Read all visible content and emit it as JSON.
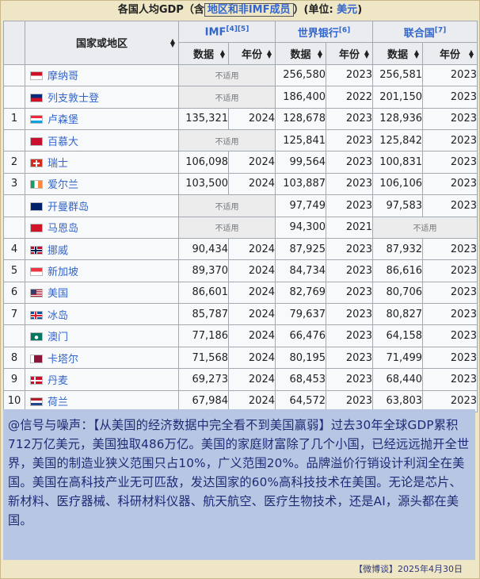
{
  "caption": {
    "prefix": "各国人均GDP（含",
    "highlight": "地区和非IMF成员",
    "suffix": "）(单位: ",
    "unit": "美元",
    "close": ")"
  },
  "headers": {
    "country": "国家或地区",
    "sources": [
      {
        "name": "IMF",
        "refs": "[4][5]"
      },
      {
        "name": "世界银行",
        "refs": "[6]"
      },
      {
        "name": "联合国",
        "refs": "[7]"
      }
    ],
    "value": "数据",
    "year": "年份"
  },
  "not_applicable": "不适用",
  "rows": [
    {
      "rank": "",
      "name": "摩纳哥",
      "flag": "monaco",
      "imf": null,
      "wb": [
        "256,580",
        "2023"
      ],
      "un": [
        "256,581",
        "2023"
      ]
    },
    {
      "rank": "",
      "name": "列支敦士登",
      "flag": "liechtenstein",
      "imf": null,
      "wb": [
        "186,400",
        "2022"
      ],
      "un": [
        "201,150",
        "2023"
      ]
    },
    {
      "rank": "1",
      "name": "卢森堡",
      "flag": "luxembourg",
      "imf": [
        "135,321",
        "2024"
      ],
      "wb": [
        "128,678",
        "2023"
      ],
      "un": [
        "128,936",
        "2023"
      ]
    },
    {
      "rank": "",
      "name": "百慕大",
      "flag": "bermuda",
      "imf": null,
      "wb": [
        "125,841",
        "2023"
      ],
      "un": [
        "125,842",
        "2023"
      ]
    },
    {
      "rank": "2",
      "name": "瑞士",
      "flag": "switzerland",
      "imf": [
        "106,098",
        "2024"
      ],
      "wb": [
        "99,564",
        "2023"
      ],
      "un": [
        "100,831",
        "2023"
      ]
    },
    {
      "rank": "3",
      "name": "爱尔兰",
      "flag": "ireland",
      "imf": [
        "103,500",
        "2024"
      ],
      "wb": [
        "103,887",
        "2023"
      ],
      "un": [
        "106,106",
        "2023"
      ]
    },
    {
      "rank": "",
      "name": "开曼群岛",
      "flag": "cayman",
      "imf": null,
      "wb": [
        "97,749",
        "2023"
      ],
      "un": [
        "97,583",
        "2023"
      ]
    },
    {
      "rank": "",
      "name": "马恩岛",
      "flag": "isleofman",
      "imf": null,
      "wb": [
        "94,300",
        "2021"
      ],
      "un": null
    },
    {
      "rank": "4",
      "name": "挪威",
      "flag": "norway",
      "imf": [
        "90,434",
        "2024"
      ],
      "wb": [
        "87,925",
        "2023"
      ],
      "un": [
        "87,932",
        "2023"
      ]
    },
    {
      "rank": "5",
      "name": "新加坡",
      "flag": "singapore",
      "imf": [
        "89,370",
        "2024"
      ],
      "wb": [
        "84,734",
        "2023"
      ],
      "un": [
        "86,616",
        "2023"
      ]
    },
    {
      "rank": "6",
      "name": "美国",
      "flag": "usa",
      "imf": [
        "86,601",
        "2024"
      ],
      "wb": [
        "82,769",
        "2023"
      ],
      "un": [
        "80,706",
        "2023"
      ]
    },
    {
      "rank": "7",
      "name": "冰岛",
      "flag": "iceland",
      "imf": [
        "85,787",
        "2024"
      ],
      "wb": [
        "79,637",
        "2023"
      ],
      "un": [
        "80,827",
        "2023"
      ]
    },
    {
      "rank": "",
      "name": "澳门",
      "flag": "macau",
      "imf": [
        "77,186",
        "2024"
      ],
      "wb": [
        "66,476",
        "2023"
      ],
      "un": [
        "64,158",
        "2023"
      ]
    },
    {
      "rank": "8",
      "name": "卡塔尔",
      "flag": "qatar",
      "imf": [
        "71,568",
        "2024"
      ],
      "wb": [
        "80,195",
        "2023"
      ],
      "un": [
        "71,499",
        "2023"
      ]
    },
    {
      "rank": "9",
      "name": "丹麦",
      "flag": "denmark",
      "imf": [
        "69,273",
        "2024"
      ],
      "wb": [
        "68,453",
        "2023"
      ],
      "un": [
        "68,440",
        "2023"
      ]
    },
    {
      "rank": "10",
      "name": "荷兰",
      "flag": "netherlands",
      "imf": [
        "67,984",
        "2024"
      ],
      "wb": [
        "64,572",
        "2023"
      ],
      "un": [
        "63,803",
        "2023"
      ]
    }
  ],
  "note": "@信号与噪声：【从美国的经济数据中完全看不到美国赢弱】过去30年全球GDP累积712万亿美元，美国独取486万亿。美国的家庭财富除了几个小国，已经远远抛开全世界，美国的制造业狭义范围只占10%，广义范围20%。品牌溢价行销设计利润全在美国。美国在高科技产业无可匹敌，发达国家的60%高科技技术在美国。无论是芯片、新材料、医疗器械、科研材料仪器、航天航空、医疗生物技术，还是AI，源头都在美国。",
  "footer": "【微博谈】2025年4月30日",
  "colors": {
    "link": "#3366cc",
    "note_bg": "#b7c6e3",
    "note_text": "#1d2a75"
  }
}
